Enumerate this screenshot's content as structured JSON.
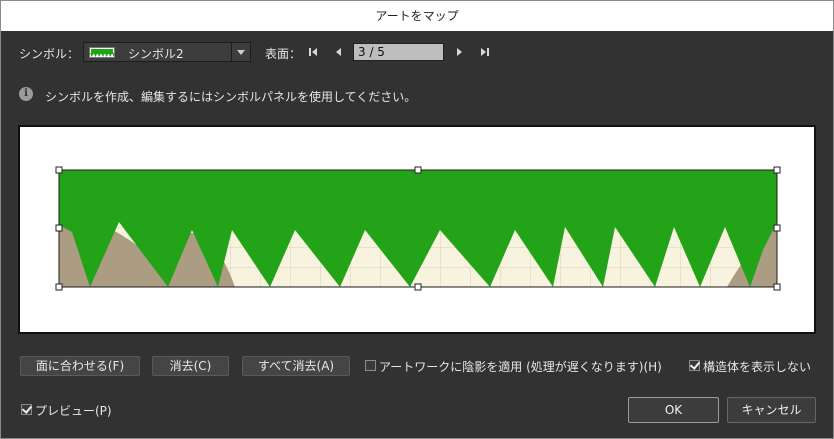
{
  "window": {
    "title": "アートをマップ"
  },
  "symbol": {
    "label": "シンボル：",
    "selected": "シンボル2"
  },
  "surface": {
    "label": "表面：",
    "page": "3 / 5",
    "first_icon": "first-page-icon",
    "prev_icon": "prev-page-icon",
    "next_icon": "next-page-icon",
    "last_icon": "last-page-icon"
  },
  "info": {
    "icon": "info-icon",
    "text": "シンボルを作成、編集するにはシンボルパネルを使用してください。"
  },
  "buttons": {
    "fit": "面に合わせる(F)",
    "clear": "消去(C)",
    "clear_all": "すべて消去(A)",
    "ok": "OK",
    "cancel": "キャンセル"
  },
  "options": {
    "shade": {
      "label": "アートワークに陰影を適用 (処理が遅くなります)(H)",
      "checked": false
    },
    "invisible": {
      "label": "構造体を表示しない",
      "checked": true
    },
    "preview": {
      "label": "プレビュー(P)",
      "checked": true
    }
  },
  "colors": {
    "art_green": "#22a318",
    "background": "#323232",
    "cream": "#f7f3df",
    "tan": "#ab9c82"
  }
}
